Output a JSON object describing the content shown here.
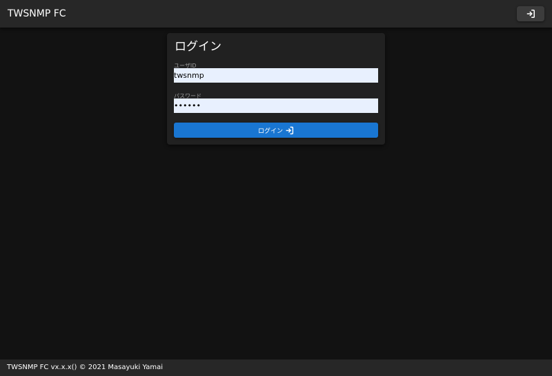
{
  "header": {
    "app_title": "TWSNMP FC",
    "login_icon": "login-icon"
  },
  "login_card": {
    "title": "ログイン",
    "user_id": {
      "label": "ユーザID",
      "value": "twsnmp"
    },
    "password": {
      "label": "パスワード",
      "value": "twsnmp"
    },
    "submit": {
      "label": "ログイン",
      "icon": "login-icon"
    }
  },
  "footer": {
    "text": "TWSNMP FC vx.x.x() © 2021 Masayuki Yamai"
  },
  "colors": {
    "background": "#121212",
    "topbar": "#272727",
    "card": "#212121",
    "input_bg": "#e8f0fe",
    "primary": "#1976d2"
  }
}
